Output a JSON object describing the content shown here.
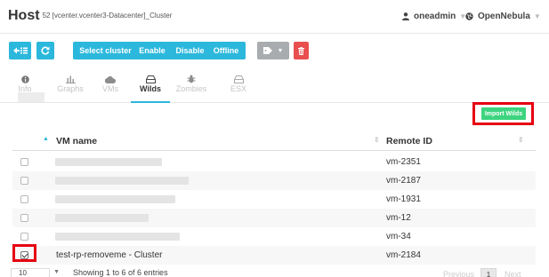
{
  "header": {
    "title": "Host",
    "subtitle": "52 [vcenter.vcenter3-Datacenter]_Cluster",
    "user": "oneadmin",
    "zone": "OpenNebula"
  },
  "toolbar": {
    "select_cluster": "Select cluster",
    "enable": "Enable",
    "disable": "Disable",
    "offline": "Offline"
  },
  "tabs": [
    {
      "label": "Info",
      "icon": "info-icon"
    },
    {
      "label": "Graphs",
      "icon": "bar-chart-icon"
    },
    {
      "label": "VMs",
      "icon": "cloud-icon"
    },
    {
      "label": "Wilds",
      "icon": "hdd-icon"
    },
    {
      "label": "Zombies",
      "icon": "bug-icon"
    },
    {
      "label": "ESX",
      "icon": "hdd-icon"
    }
  ],
  "import_wilds": "Import Wilds",
  "table": {
    "columns": [
      "VM name",
      "Remote ID"
    ],
    "rows": [
      {
        "name": "",
        "remote_id": "vm-2351",
        "checked": false
      },
      {
        "name": "",
        "remote_id": "vm-2187",
        "checked": false
      },
      {
        "name": "",
        "remote_id": "vm-1931",
        "checked": false
      },
      {
        "name": "",
        "remote_id": "vm-12",
        "checked": false
      },
      {
        "name": "",
        "remote_id": "vm-34",
        "checked": false
      },
      {
        "name": "test-rp-removeme - Cluster",
        "remote_id": "vm-2184",
        "checked": true
      }
    ]
  },
  "footer": {
    "page_length": "10",
    "showing": "Showing 1 to 6 of 6 entries",
    "previous": "Previous",
    "current_page": "1",
    "next": "Next"
  },
  "colors": {
    "accent": "#2bb8dc",
    "import_button": "#3dd47f",
    "delete_button": "#e94f4f",
    "highlight_frame": "#e60012"
  }
}
